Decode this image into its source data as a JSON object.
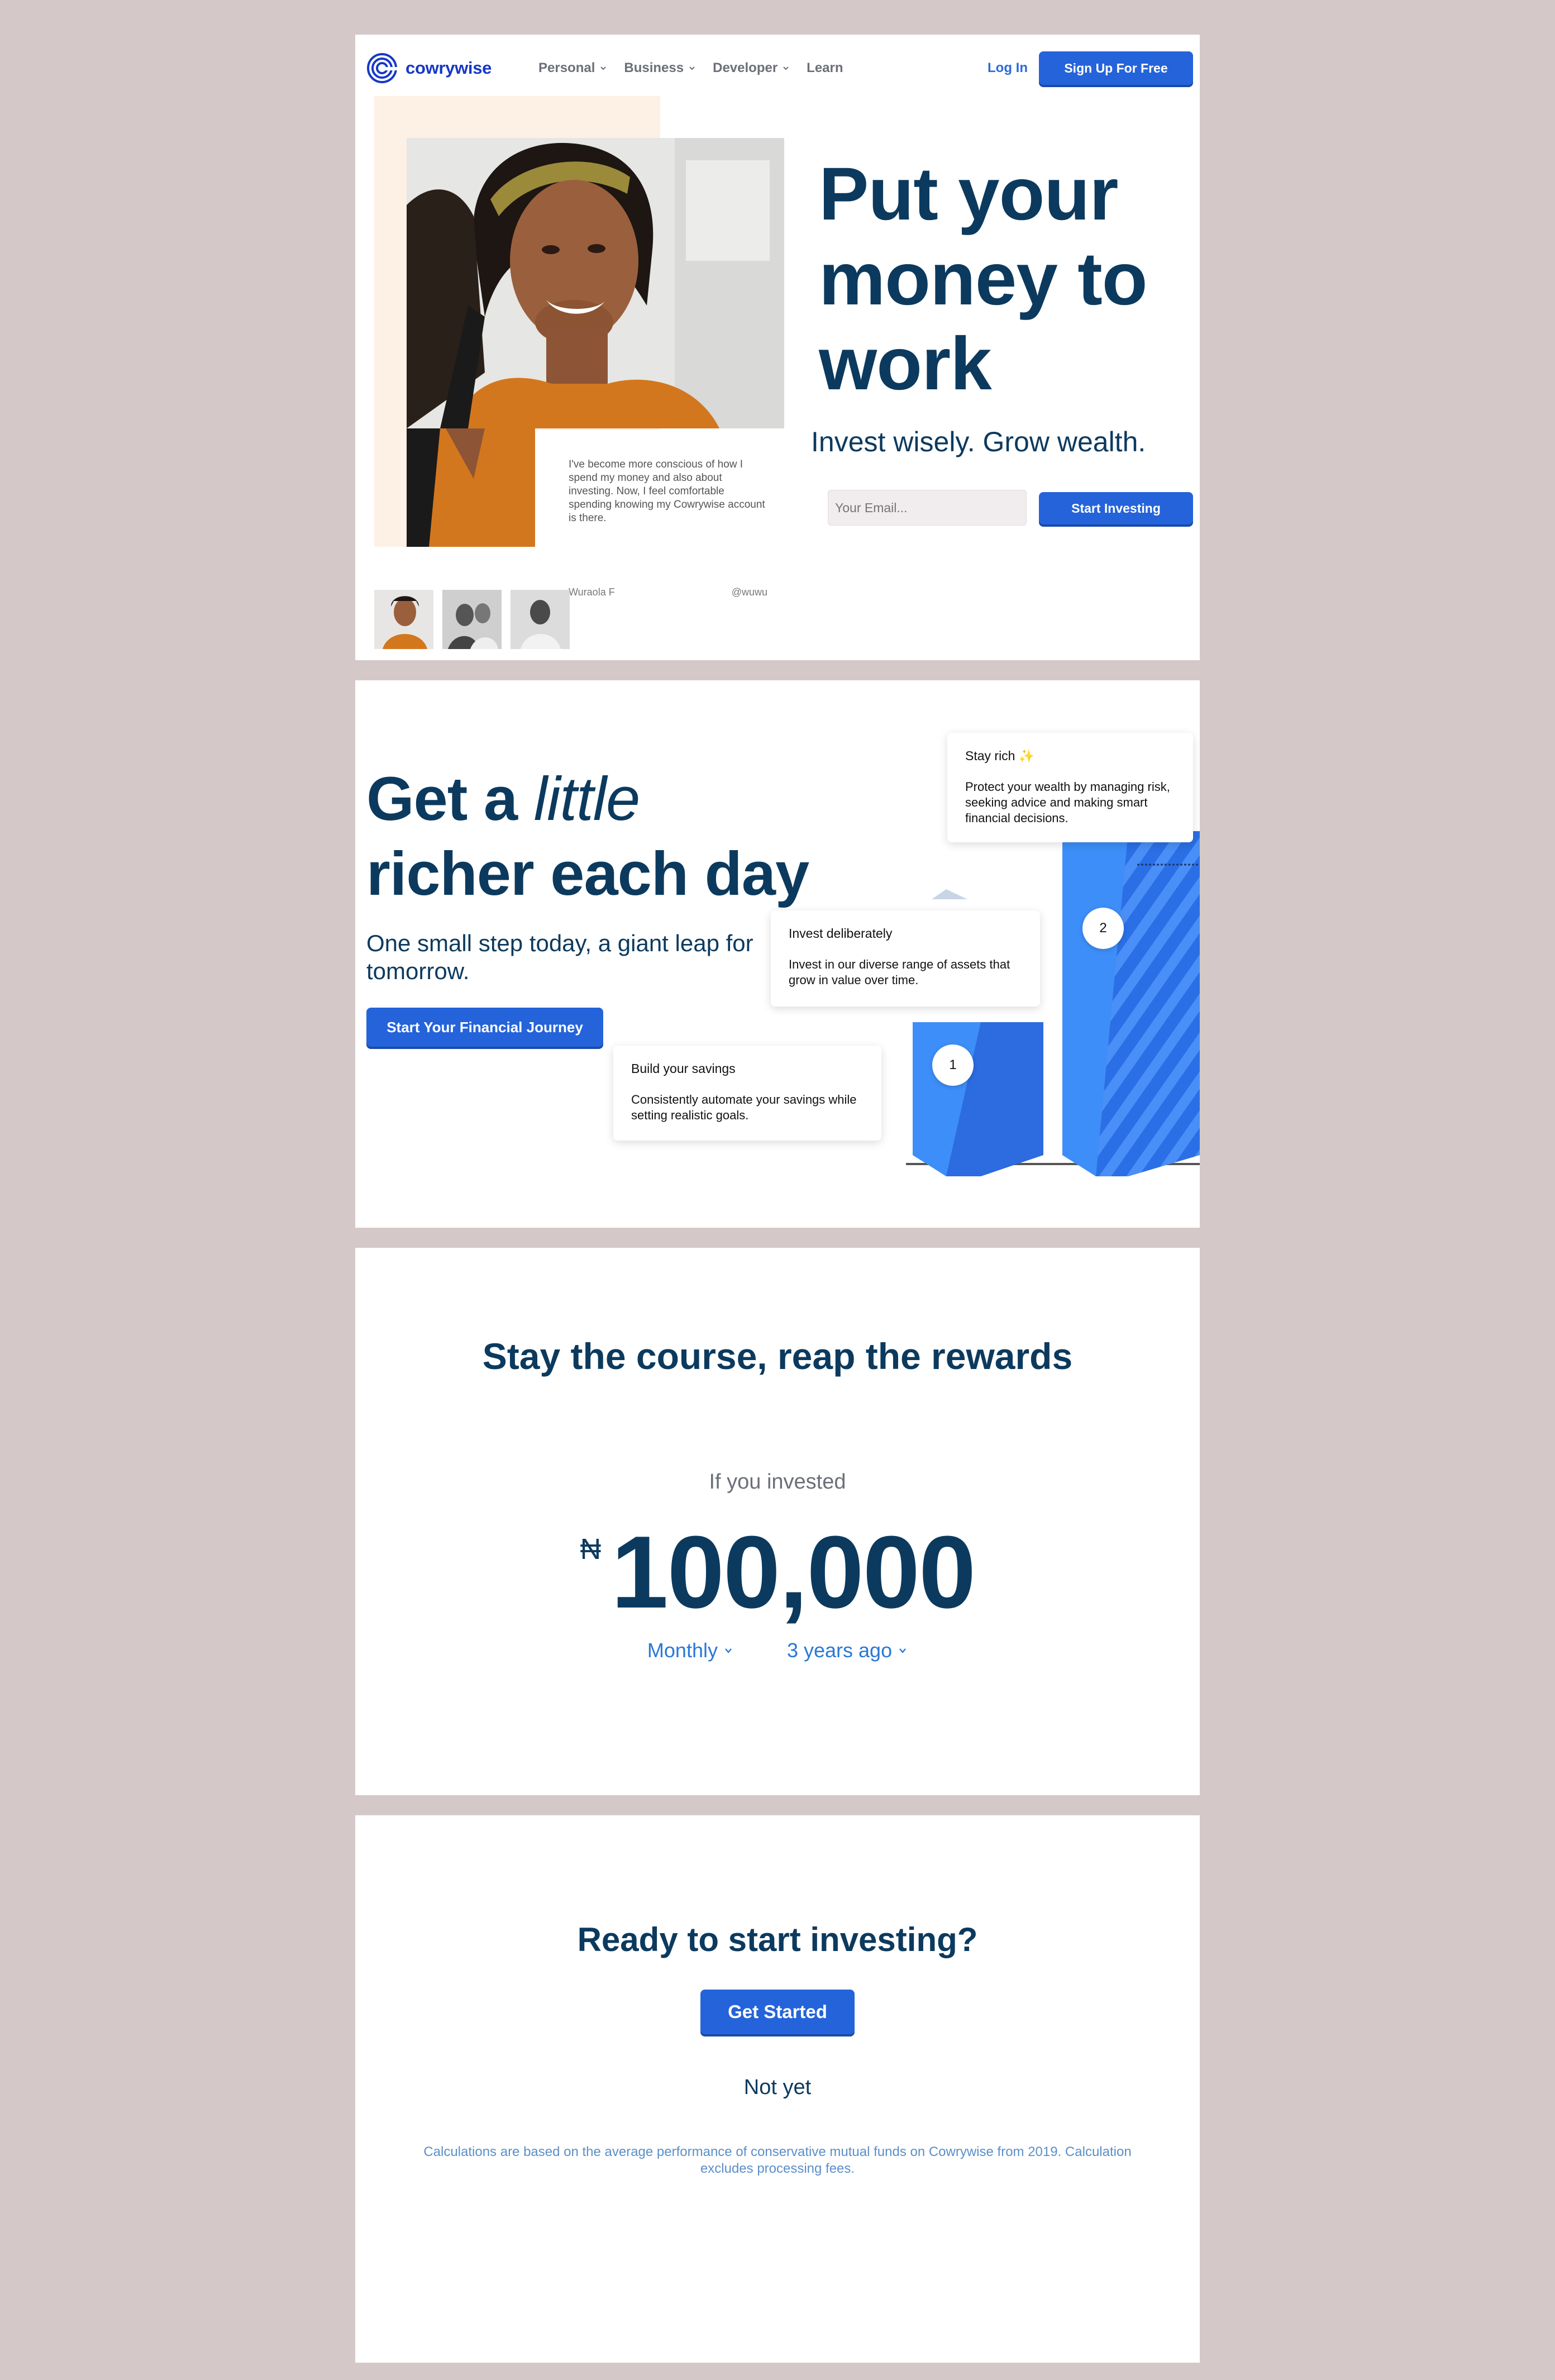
{
  "brand": {
    "name": "cowrywise",
    "color": "#1638c6",
    "accent": "#2463da",
    "heading_color": "#0c3a5e"
  },
  "nav": {
    "items": [
      {
        "label": "Personal",
        "dropdown": true
      },
      {
        "label": "Business",
        "dropdown": true
      },
      {
        "label": "Developer",
        "dropdown": true
      },
      {
        "label": "Learn",
        "dropdown": false
      }
    ],
    "login": "Log In",
    "signup": "Sign Up For Free"
  },
  "hero": {
    "title": "Put your money to work",
    "subtitle": "Invest wisely. Grow wealth.",
    "email_placeholder": "Your Email...",
    "cta": "Start Investing",
    "testimonial": {
      "quote": "I've become more conscious of how I spend my money and also about investing. Now, I feel comfortable spending knowing my Cowrywise account is there.",
      "name": "Wuraola F",
      "handle": "@wuwu"
    }
  },
  "richer": {
    "title_start": "Get a",
    "title_italic": "little",
    "title_end": "richer each day",
    "subtitle": "One small step today, a giant leap for tomorrow.",
    "cta": "Start Your Financial Journey",
    "steps": [
      {
        "num": "1",
        "title": "Build your savings",
        "body": "Consistently automate your savings while setting realistic goals."
      },
      {
        "num": "2",
        "title": "Invest deliberately",
        "body": "Invest in our diverse range of assets that grow in value over time."
      },
      {
        "num": "",
        "title": "Stay rich",
        "sparkle": "✨",
        "body": "Protect your wealth by managing risk, seeking advice and making smart financial decisions."
      }
    ]
  },
  "calculator": {
    "title": "Stay the course, reap the rewards",
    "prompt": "If you invested",
    "currency": "₦",
    "amount": "100,000",
    "frequency": "Monthly",
    "period": "3 years ago"
  },
  "final_cta": {
    "title": "Ready to start investing?",
    "button": "Get Started",
    "secondary": "Not yet",
    "disclaimer": "Calculations are based on the average performance of conservative mutual funds on Cowrywise from 2019. Calculation excludes processing fees."
  }
}
